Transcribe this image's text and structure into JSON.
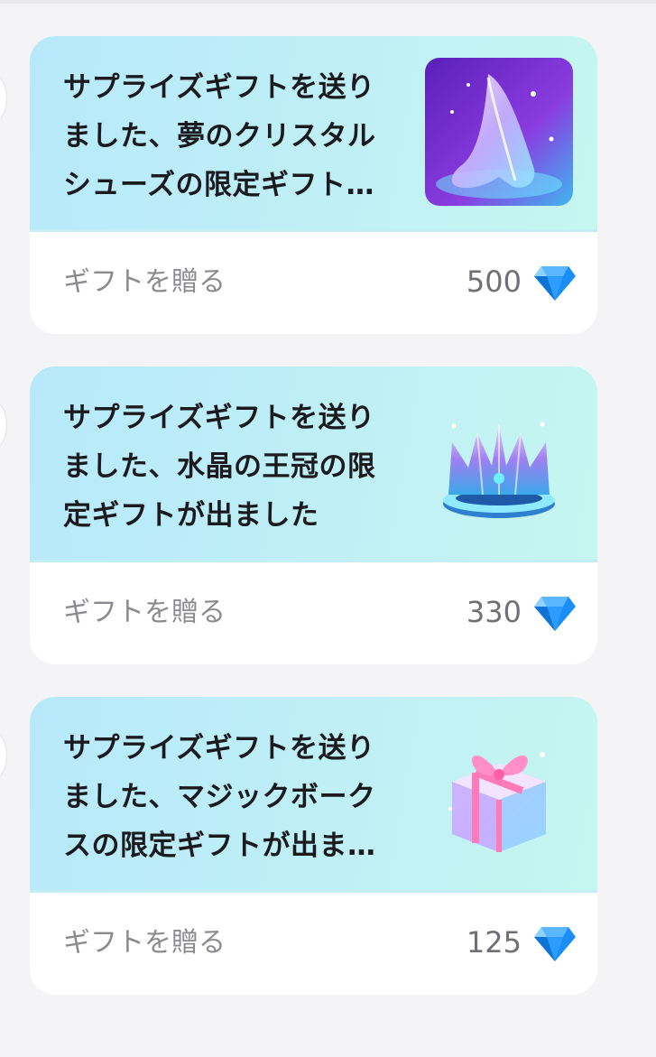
{
  "cards": [
    {
      "title_lines": [
        "サプライズギフトを送り",
        "ました、夢のクリスタル",
        "シューズの限定ギフト…"
      ],
      "action_label": "ギフトを贈る",
      "price": "500",
      "gift_icon": "crystal-shoe-icon"
    },
    {
      "title_lines": [
        "サプライズギフトを送り",
        "ました、水晶の王冠の限",
        "定ギフトが出ました"
      ],
      "action_label": "ギフトを贈る",
      "price": "330",
      "gift_icon": "crystal-crown-icon"
    },
    {
      "title_lines": [
        "サプライズギフトを送り",
        "ました、マジックボーク",
        "スの限定ギフトが出ま…"
      ],
      "action_label": "ギフトを贈る",
      "price": "125",
      "gift_icon": "magic-gift-box-icon"
    }
  ],
  "colors": {
    "card_top_gradient_start": "#b7e9fb",
    "card_top_gradient_end": "#c6f6f0",
    "diamond": "#1a8ef5",
    "label_gray": "#8a8a90"
  }
}
